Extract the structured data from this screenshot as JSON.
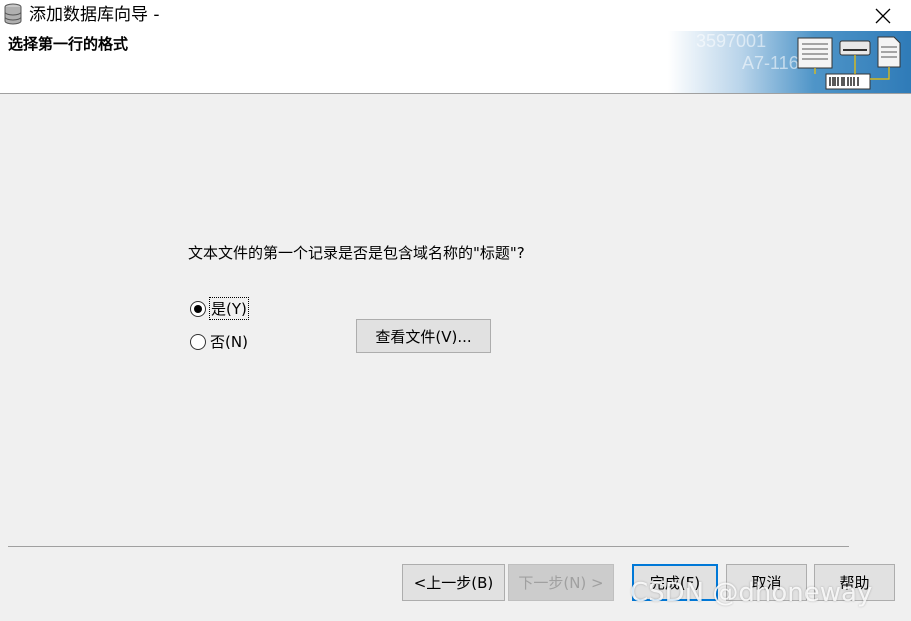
{
  "window": {
    "title": "添加数据库向导 -"
  },
  "header": {
    "step_title": "选择第一行的格式",
    "banner_text_1": "3597001",
    "banner_text_2": "A7-116"
  },
  "content": {
    "question": "文本文件的第一个记录是否是包含域名称的\"标题\"?",
    "options": [
      {
        "label": "是(Y)",
        "selected": true
      },
      {
        "label": "否(N)",
        "selected": false
      }
    ],
    "view_file_label": "查看文件(V)..."
  },
  "footer": {
    "back_label": "<上一步(B)",
    "next_label": "下一步(N) >",
    "finish_label": "完成(F)",
    "cancel_label": "取消",
    "help_label": "帮助"
  },
  "watermark": "CSDN @dhoneway",
  "colors": {
    "accent": "#0078d7",
    "banner": "#3b8ac4"
  },
  "icons": [
    "database-icon",
    "close-icon",
    "document-icon",
    "drive-icon",
    "barcode-icon"
  ]
}
